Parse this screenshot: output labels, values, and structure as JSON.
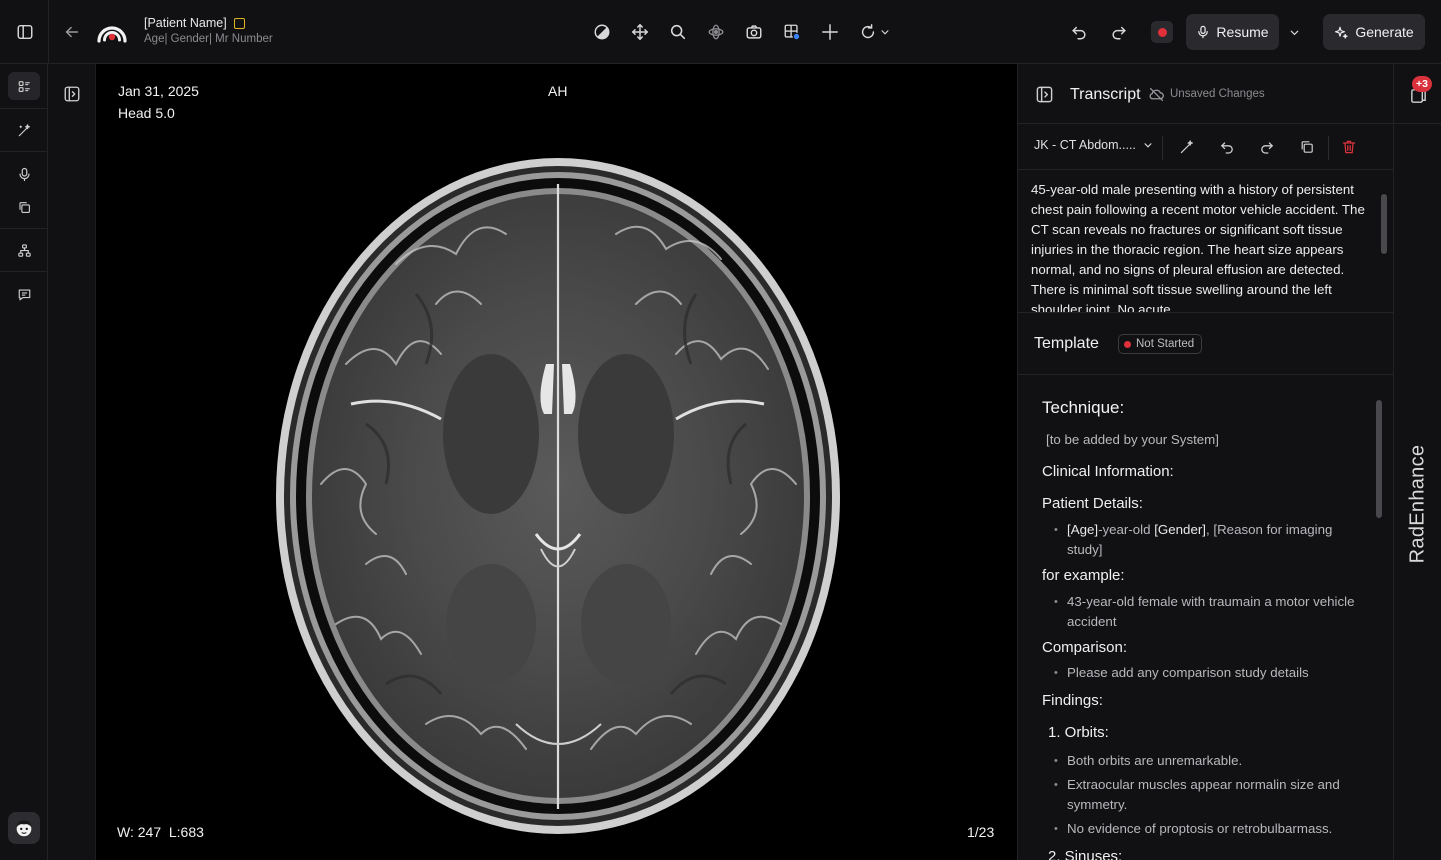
{
  "header": {
    "patient_name": "[Patient Name]",
    "patient_meta": "Age| Gender| Mr Number",
    "resume_label": "Resume",
    "generate_label": "Generate"
  },
  "viewer": {
    "date": "Jan 31, 2025",
    "series": "Head 5.0",
    "orientation": "AH",
    "window_level": "W: 247  L:683",
    "slice": "1/23"
  },
  "transcript": {
    "title": "Transcript",
    "status": "Unsaved Changes",
    "selected_template": "JK - CT Abdom.....",
    "text": "45-year-old male presenting with a history of persistent chest pain following a recent motor vehicle accident. The CT scan reveals no fractures or significant soft tissue injuries in the thoracic region. The heart size appears normal, and no signs of pleural effusion are detected. There is minimal soft tissue swelling around the left shoulder joint. No acute"
  },
  "template": {
    "title": "Template",
    "status": "Not Started",
    "technique_heading": "Technique:",
    "technique_text": "[to be added by your System]",
    "clinical_heading": "Clinical Information:",
    "patient_details_heading": "Patient Details:",
    "patient_age": "[Age]",
    "patient_mid": "-year-old ",
    "patient_gender": "[Gender]",
    "patient_reason": ", [Reason for imaging study]",
    "example_heading": "for example:",
    "example_text": "43-year-old female with traumain a motor vehicle accident",
    "comparison_heading": "Comparison:",
    "comparison_text": "Please add any comparison study details",
    "findings_heading": "Findings:",
    "orbits_heading": "1. Orbits:",
    "orbits_items": [
      "Both orbits are unremarkable.",
      "Extraocular muscles appear normalin size and symmetry.",
      "No evidence of proptosis or retrobulbarmass."
    ],
    "sinuses_heading": "2. Sinuses:"
  },
  "right_rail": {
    "badge": "+3",
    "brand": "RadEnhance"
  },
  "colors": {
    "record": "#e0303a",
    "warning_flag": "#e0b521",
    "badge": "#d9323d"
  }
}
